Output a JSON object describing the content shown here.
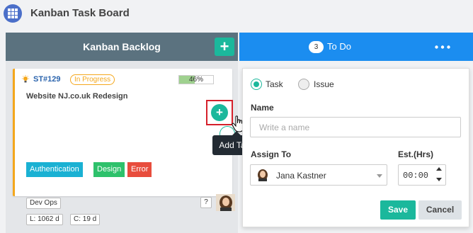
{
  "app": {
    "title": "Kanban Task Board",
    "icon": "grid-icon",
    "accent_color": "#4b6fc9"
  },
  "columns": {
    "backlog": {
      "title": "Kanban Backlog",
      "header_color": "#5b727f",
      "add_label": "+"
    },
    "todo": {
      "title": "To Do",
      "count": "3",
      "header_color": "#1b8df0",
      "menu_icon": "more-horizontal-icon"
    }
  },
  "card": {
    "id": "ST#129",
    "status": "In Progress",
    "status_color": "#f4a71c",
    "progress_percent": 46,
    "progress_label": "46%",
    "title": "Website NJ.co.uk Redesign",
    "tags": [
      {
        "label": "Authentication",
        "color": "#1ab1d3"
      },
      {
        "label": "Design",
        "color": "#2ec16b"
      },
      {
        "label": "Error",
        "color": "#e84d3d"
      }
    ],
    "team": "Dev Ops",
    "lead_time": "L: 1062 d",
    "cycle_time": "C: 19 d",
    "unknown_label": "?",
    "add_task_label": "+"
  },
  "tooltip": {
    "text": "Add Task"
  },
  "form": {
    "type_options": [
      "Task",
      "Issue"
    ],
    "selected_type": "Task",
    "name_label": "Name",
    "name_placeholder": "Write a name",
    "name_value": "",
    "assign_label": "Assign To",
    "assign_value": "Jana Kastner",
    "est_label": "Est.(Hrs)",
    "est_value": "00:00",
    "save_label": "Save",
    "cancel_label": "Cancel",
    "save_color": "#1bb89c"
  }
}
